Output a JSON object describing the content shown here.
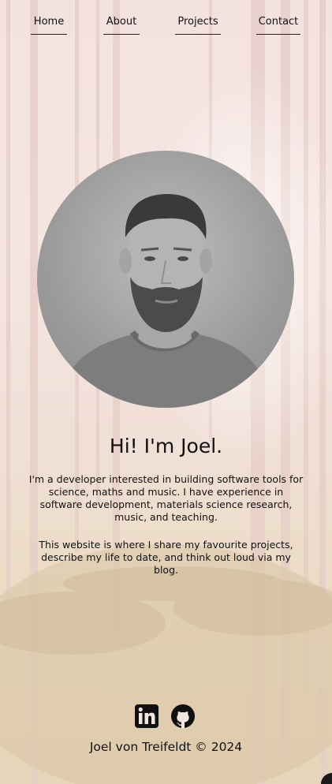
{
  "nav": {
    "home": "Home",
    "about": "About",
    "projects": "Projects",
    "contact": "Contact"
  },
  "hero": {
    "heading": "Hi! I'm Joel.",
    "paragraph_1": "I'm a developer interested in building software tools for science, maths and music. I have experience in software development, materials science research, music, and teaching.",
    "paragraph_2": "This website is where I share my favourite projects, describe my life to date, and think out loud via my blog."
  },
  "social": {
    "icons": [
      "linkedin-icon",
      "github-icon"
    ]
  },
  "footer": {
    "text": "Joel von Treifeldt © 2024"
  }
}
